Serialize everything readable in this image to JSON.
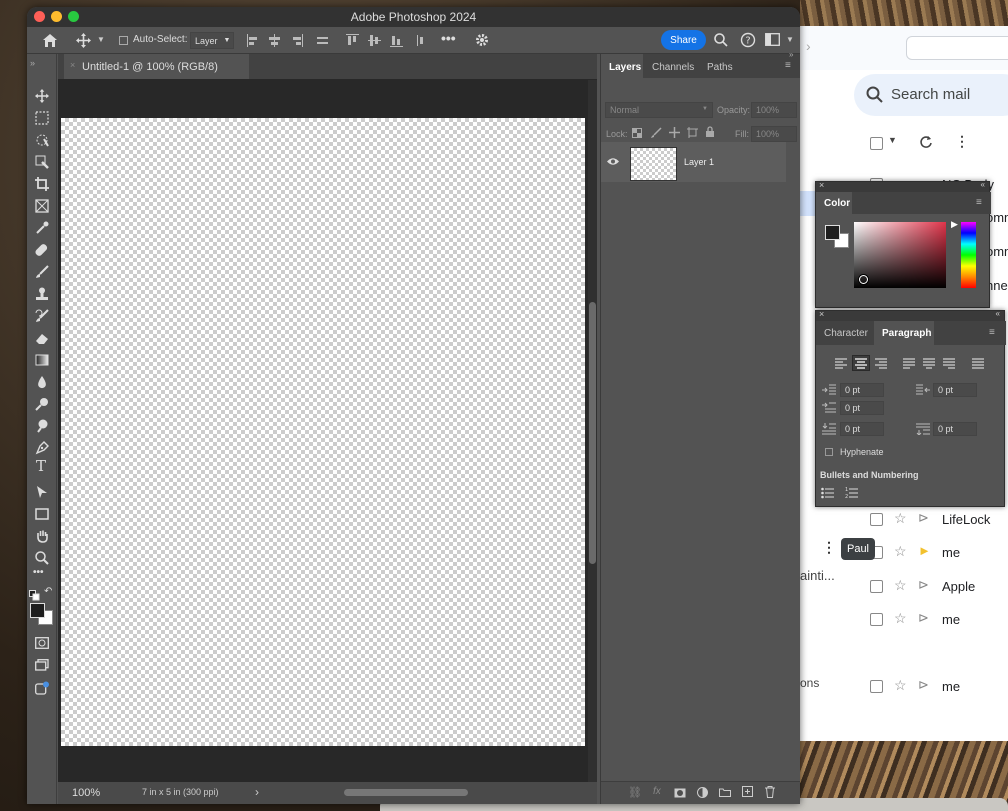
{
  "window": {
    "title": "Adobe Photoshop 2024"
  },
  "options_bar": {
    "auto_select_label": "Auto-Select:",
    "auto_select_target": "Layer",
    "share_label": "Share"
  },
  "document": {
    "tab_title": "Untitled-1 @ 100% (RGB/8)",
    "zoom": "100%",
    "doc_info": "7 in x 5 in (300 ppi)"
  },
  "layers_panel": {
    "tabs": [
      "Layers",
      "Channels",
      "Paths"
    ],
    "blend_mode": "Normal",
    "opacity_label": "Opacity:",
    "opacity_value": "100%",
    "lock_label": "Lock:",
    "fill_label": "Fill:",
    "fill_value": "100%",
    "layer_name": "Layer 1"
  },
  "color_panel": {
    "title": "Color",
    "colors": {
      "hue_red": "#e0344a",
      "foreground": "#1e1e1e",
      "background": "#ffffff"
    }
  },
  "paragraph_panel": {
    "tabs": [
      "Character",
      "Paragraph"
    ],
    "indent_left": "0 pt",
    "indent_right": "0 pt",
    "indent_first": "0 pt",
    "space_before": "0 pt",
    "space_after": "0 pt",
    "hyphenate_label": "Hyphenate",
    "bullets_label": "Bullets and Numbering"
  },
  "gmail": {
    "search_placeholder": "Search mail",
    "tooltip": "Paul",
    "rows": [
      {
        "sender": "NC Body Fo"
      },
      {
        "sender": "omm"
      },
      {
        "sender": "omm"
      },
      {
        "sender": "nne"
      },
      {
        "sender": "LifeLock"
      },
      {
        "sender": "me"
      },
      {
        "sender": "Apple"
      },
      {
        "sender": "me"
      },
      {
        "sender": "me"
      }
    ],
    "left_snippets": [
      "ainti...",
      "ons"
    ]
  }
}
